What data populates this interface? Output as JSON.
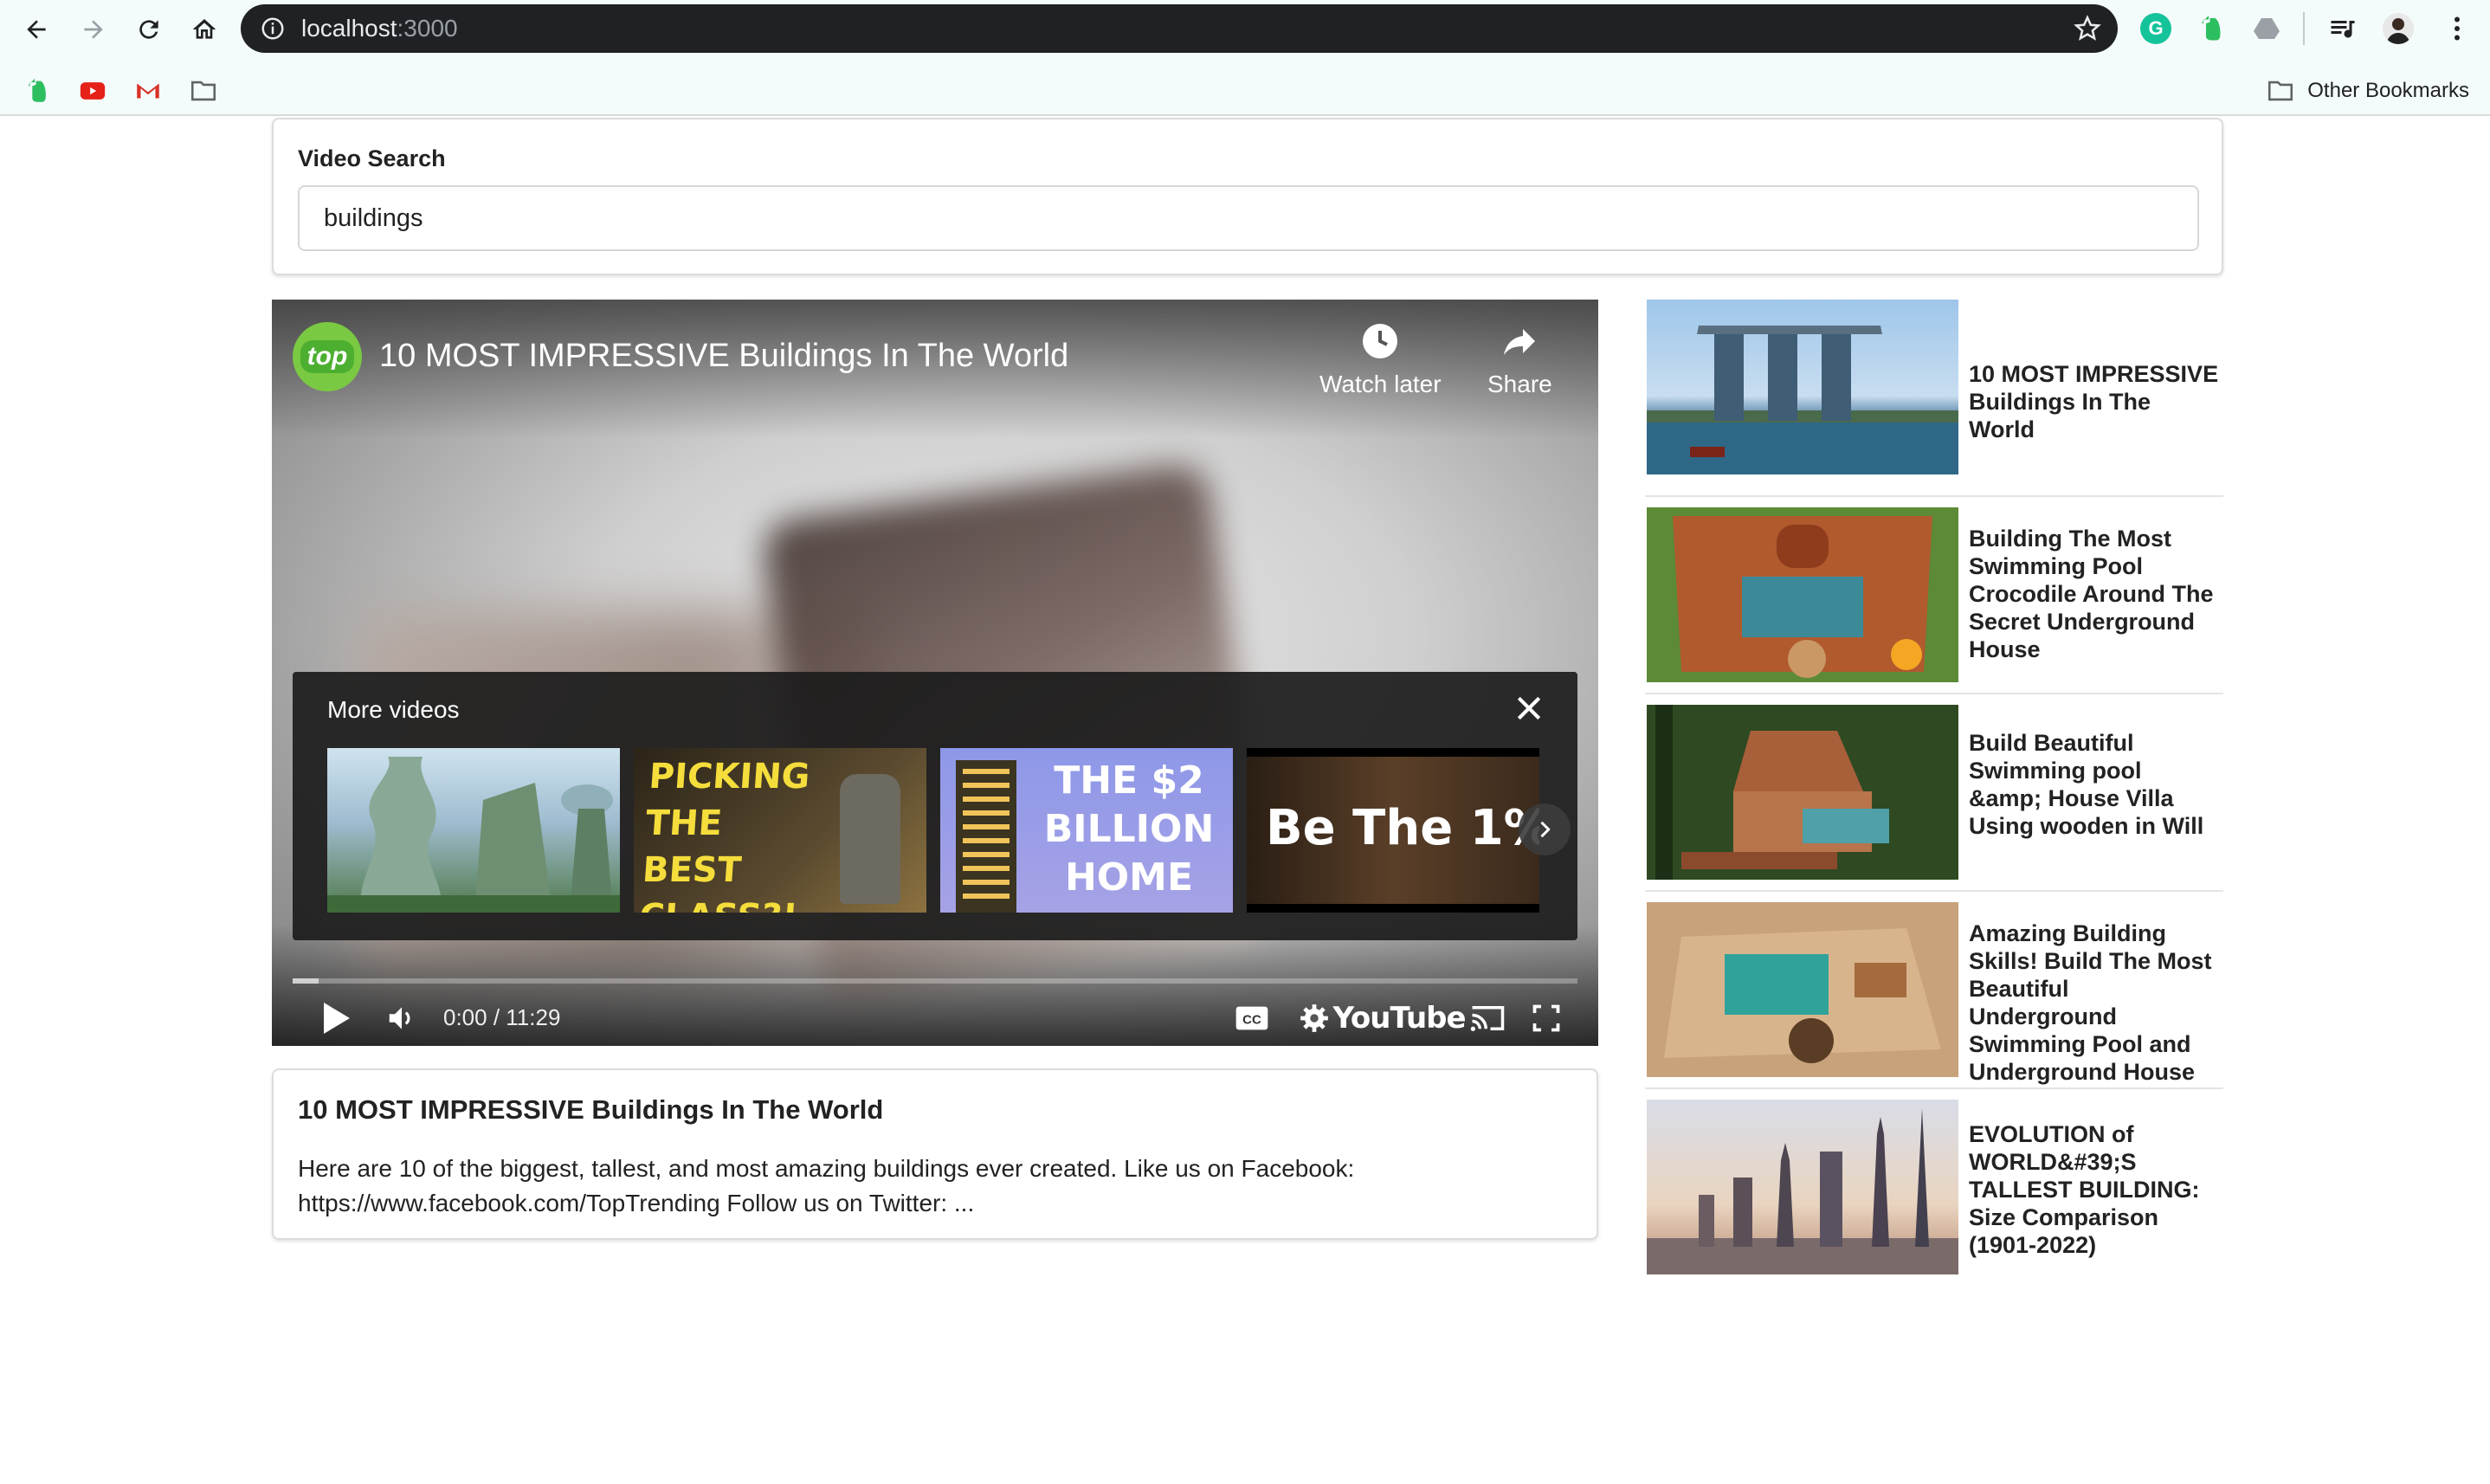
{
  "browser": {
    "url_host": "localhost",
    "url_port": ":3000",
    "other_bookmarks": "Other Bookmarks"
  },
  "search": {
    "label": "Video Search",
    "value": "buildings"
  },
  "player": {
    "title": "10 MOST IMPRESSIVE Buildings In The World",
    "channel_logo_text": "top",
    "watch_later": "Watch later",
    "share": "Share",
    "more_videos": "More videos",
    "time": "0:00 / 11:29",
    "progress": 0.02,
    "youtube_logo": "YouTube",
    "more_thumbs": [
      {
        "text": ""
      },
      {
        "text": "PICKING THE BEST CLASS?!"
      },
      {
        "text": "THE $2 BILLION HOME"
      },
      {
        "text": "Be The 1%"
      }
    ]
  },
  "selected": {
    "title": "10 MOST IMPRESSIVE Buildings In The World",
    "description": "Here are 10 of the biggest, tallest, and most amazing buildings ever created. Like us on Facebook: https://www.facebook.com/TopTrending Follow us on Twitter: ..."
  },
  "videos": [
    {
      "title": "10 MOST IMPRESSIVE Buildings In The World"
    },
    {
      "title": "Building The Most Swimming Pool Crocodile Around The Secret Underground House"
    },
    {
      "title": "Build Beautiful Swimming pool &amp; House Villa Using wooden in Will"
    },
    {
      "title": "Amazing Building Skills! Build The Most Beautiful Underground Swimming Pool and Underground House"
    },
    {
      "title": "EVOLUTION of WORLD&#39;S TALLEST BUILDING: Size Comparison (1901-2022)"
    }
  ]
}
